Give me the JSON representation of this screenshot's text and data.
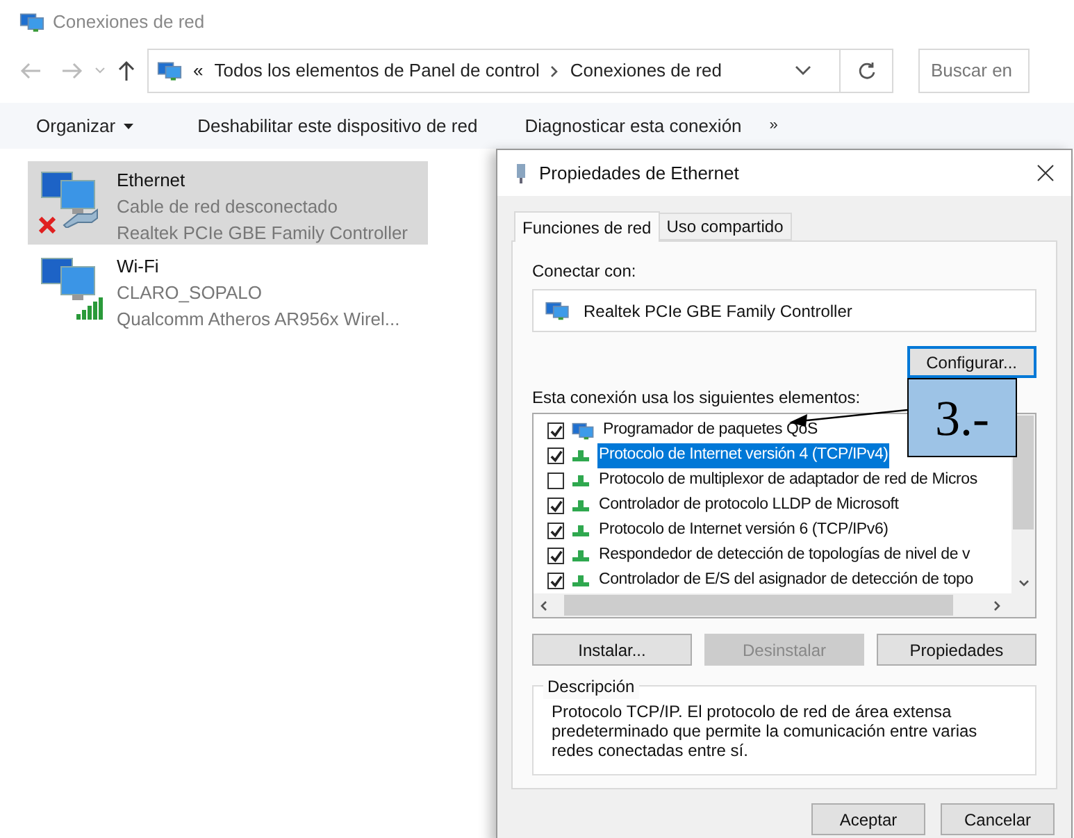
{
  "window": {
    "title": "Conexiones de red"
  },
  "address_bar": {
    "crumbs": [
      "«",
      "Todos los elementos de Panel de control",
      "Conexiones de red"
    ],
    "search_placeholder": "Buscar en"
  },
  "toolbar": [
    {
      "label": "Organizar",
      "kind": "menu"
    },
    {
      "label": "Deshabilitar este dispositivo de red",
      "kind": "command"
    },
    {
      "label": "Diagnosticar esta conexión",
      "kind": "command"
    },
    {
      "label": "»",
      "kind": "more"
    }
  ],
  "connections": [
    {
      "name": "Ethernet",
      "status": "Cable de red desconectado",
      "adapter": "Realtek PCIe GBE Family Controller",
      "kind": "ethernet",
      "selected": true
    },
    {
      "name": "Wi-Fi",
      "status": "CLARO_SOPALO",
      "adapter": "Qualcomm Atheros AR956x Wirel...",
      "kind": "wifi",
      "selected": false
    }
  ],
  "dialog": {
    "title": "Propiedades de Ethernet",
    "tabs": [
      {
        "label": "Funciones de red",
        "selected": true
      },
      {
        "label": "Uso compartido",
        "selected": false
      }
    ],
    "connect_label": "Conectar con:",
    "adapter": "Realtek PCIe GBE Family Controller",
    "configure_button": "Configurar...",
    "items_label": "Esta conexión usa los siguientes elementos:",
    "items": [
      {
        "label": "Programador de paquetes QoS",
        "kind": "service",
        "checked": true,
        "selected": false
      },
      {
        "label": "Protocolo de Internet versión 4 (TCP/IPv4)",
        "kind": "protocol",
        "checked": true,
        "selected": true
      },
      {
        "label": "Protocolo de multiplexor de adaptador de red de Micros",
        "kind": "protocol",
        "checked": false,
        "selected": false
      },
      {
        "label": "Controlador de protocolo LLDP de Microsoft",
        "kind": "protocol",
        "checked": true,
        "selected": false
      },
      {
        "label": "Protocolo de Internet versión 6 (TCP/IPv6)",
        "kind": "protocol",
        "checked": true,
        "selected": false
      },
      {
        "label": "Respondedor de detección de topologías de nivel de v",
        "kind": "protocol",
        "checked": true,
        "selected": false
      },
      {
        "label": "Controlador de E/S del asignador de detección de topo",
        "kind": "protocol",
        "checked": true,
        "selected": false
      }
    ],
    "item_buttons": [
      {
        "label": "Instalar...",
        "disabled": false
      },
      {
        "label": "Desinstalar",
        "disabled": true
      },
      {
        "label": "Propiedades",
        "disabled": false
      }
    ],
    "description_title": "Descripción",
    "description": "Protocolo TCP/IP. El protocolo de red de área extensa predeterminado que permite la comunicación entre varias redes conectadas entre sí.",
    "footer_buttons": [
      "Aceptar",
      "Cancelar"
    ]
  },
  "callout": {
    "text": "3.-"
  }
}
